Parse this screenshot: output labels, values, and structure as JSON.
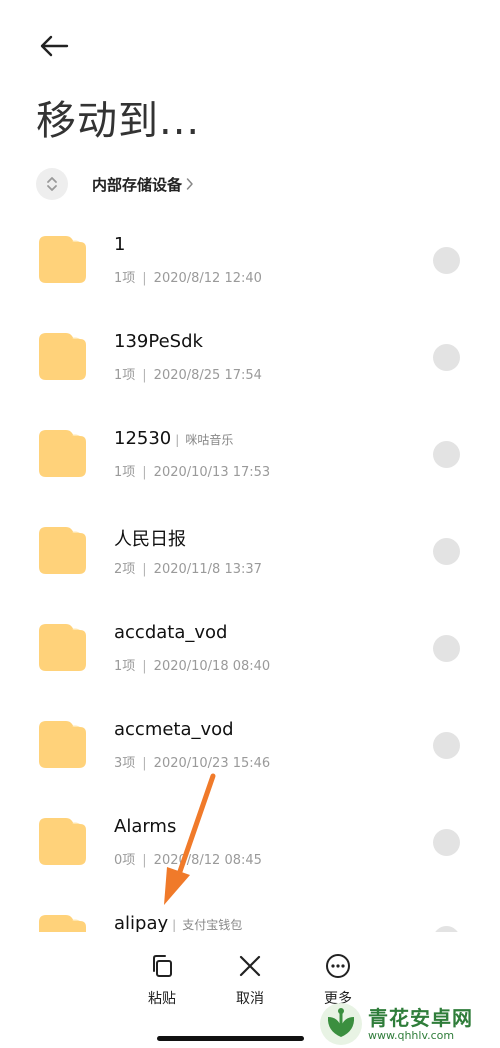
{
  "header": {
    "back_icon": "arrow-left-icon",
    "title": "移动到..."
  },
  "path": {
    "sort_icon": "sort-updown-icon",
    "label": "内部存储设备",
    "chevron_icon": "chevron-right-icon"
  },
  "files": [
    {
      "name": "1",
      "tag": "",
      "count": "1项",
      "date": "2020/8/12 12:40"
    },
    {
      "name": "139PeSdk",
      "tag": "",
      "count": "1项",
      "date": "2020/8/25 17:54"
    },
    {
      "name": "12530",
      "tag": "咪咕音乐",
      "count": "1项",
      "date": "2020/10/13 17:53"
    },
    {
      "name": "人民日报",
      "tag": "",
      "count": "2项",
      "date": "2020/11/8 13:37"
    },
    {
      "name": "accdata_vod",
      "tag": "",
      "count": "1项",
      "date": "2020/10/18 08:40"
    },
    {
      "name": "accmeta_vod",
      "tag": "",
      "count": "3项",
      "date": "2020/10/23 15:46"
    },
    {
      "name": "Alarms",
      "tag": "",
      "count": "0项",
      "date": "2020/8/12 08:45"
    },
    {
      "name": "alipay",
      "tag": "支付宝钱包",
      "count": "",
      "date": ""
    }
  ],
  "toolbar": {
    "paste_label": "粘贴",
    "cancel_label": "取消",
    "more_label": "更多"
  },
  "watermark": {
    "title": "青花安卓网",
    "url": "www.qhhlv.com"
  },
  "colors": {
    "folder": "#FFD27A",
    "radio": "#E3E3E3",
    "arrow": "#F07A2A",
    "watermark": "#2F7D3A"
  }
}
